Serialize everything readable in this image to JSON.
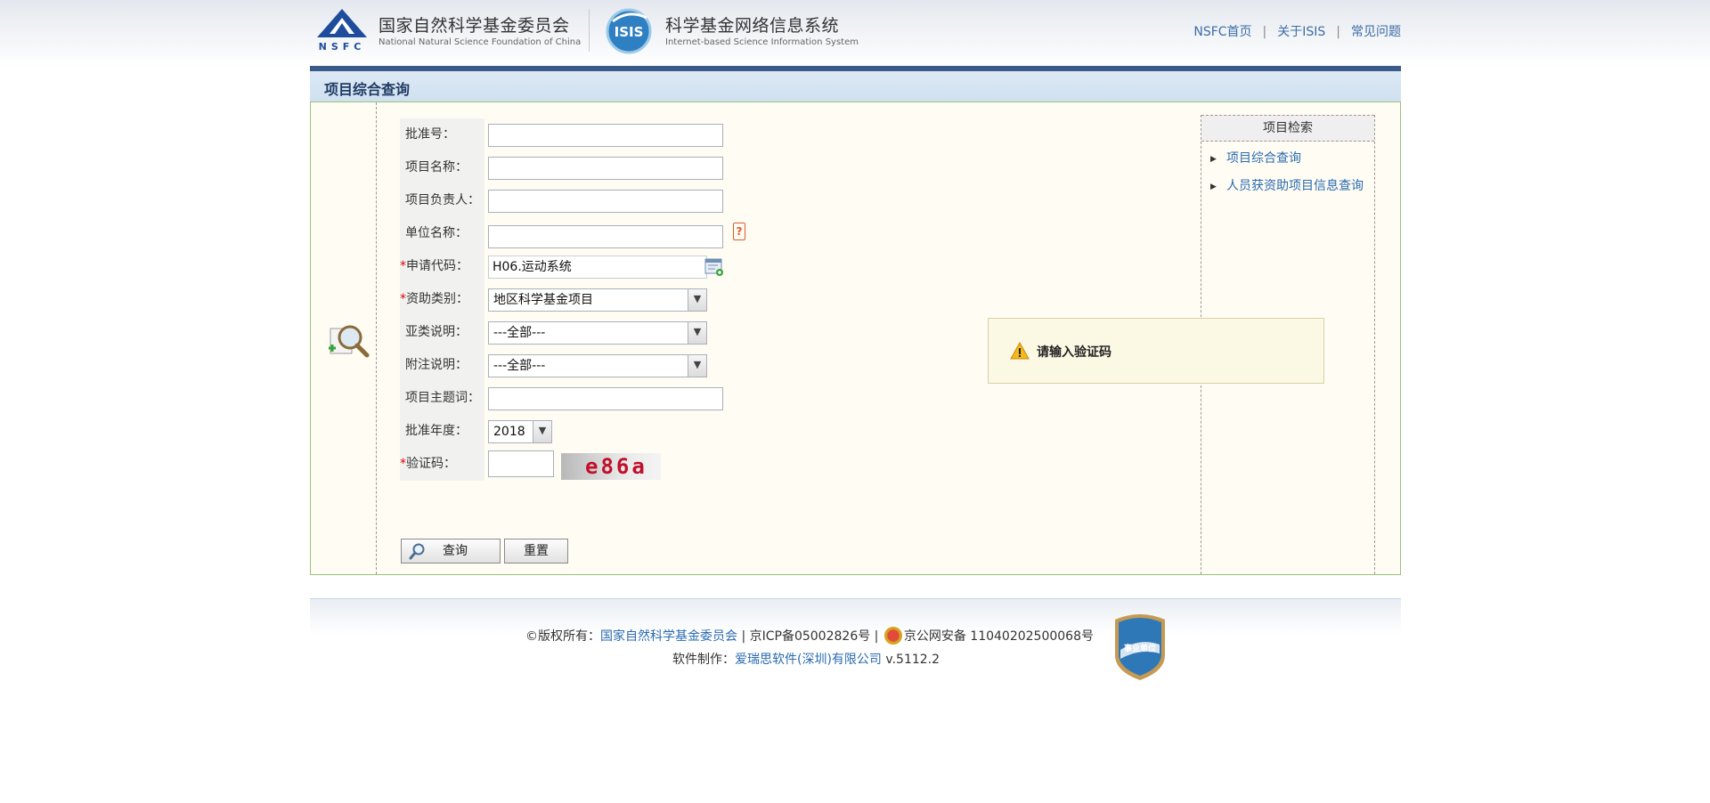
{
  "header": {
    "nsfc_cn": "国家自然科学基金委员会",
    "nsfc_en": "National Natural Science Foundation of China",
    "nsfc_mark_text": "NSFC",
    "isis_mark_text": "ISIS",
    "isis_cn": "科学基金网络信息系统",
    "isis_en": "Internet-based Science Information System",
    "links": [
      "NSFC首页",
      "关于ISIS",
      "常见问题"
    ]
  },
  "title": "项目综合查询",
  "form": {
    "approval_no": {
      "label": "批准号：",
      "value": ""
    },
    "project_name": {
      "label": "项目名称：",
      "value": ""
    },
    "leader": {
      "label": "项目负责人：",
      "value": ""
    },
    "org_name": {
      "label": "单位名称：",
      "value": "",
      "help": "?"
    },
    "apply_code": {
      "required": "*",
      "label": "申请代码：",
      "value": "H06.运动系统"
    },
    "funding_type": {
      "required": "*",
      "label": "资助类别：",
      "value": "地区科学基金项目"
    },
    "subcategory": {
      "label": "亚类说明：",
      "value": "---全部---"
    },
    "note": {
      "label": "附注说明：",
      "value": "---全部---"
    },
    "keywords": {
      "label": "项目主题词：",
      "value": ""
    },
    "year": {
      "label": "批准年度：",
      "value": "2018"
    },
    "captcha": {
      "required": "*",
      "label": "验证码：",
      "value": "",
      "image_text": "e86a"
    },
    "query_button": "查询",
    "reset_button": "重置"
  },
  "popup": {
    "message": "请输入验证码"
  },
  "right_nav": {
    "heading": "项目检索",
    "items": [
      "项目综合查询",
      "人员获资助项目信息查询"
    ]
  },
  "footer": {
    "copyright_prefix": "©版权所有：",
    "copyright_link": "国家自然科学基金委员会",
    "icp": " | 京ICP备05002826号 | ",
    "police": "京公网安备 11040202500068号",
    "made_prefix": "软件制作：",
    "made_link": "爱瑞思软件(深圳)有限公司",
    "version": " v.5112.2",
    "badge_text": "事业单位"
  },
  "colors": {
    "link": "#2a6ab0",
    "title_bar": "#3a5a8a",
    "panel_border": "#9cc27d",
    "required": "#e00000"
  }
}
